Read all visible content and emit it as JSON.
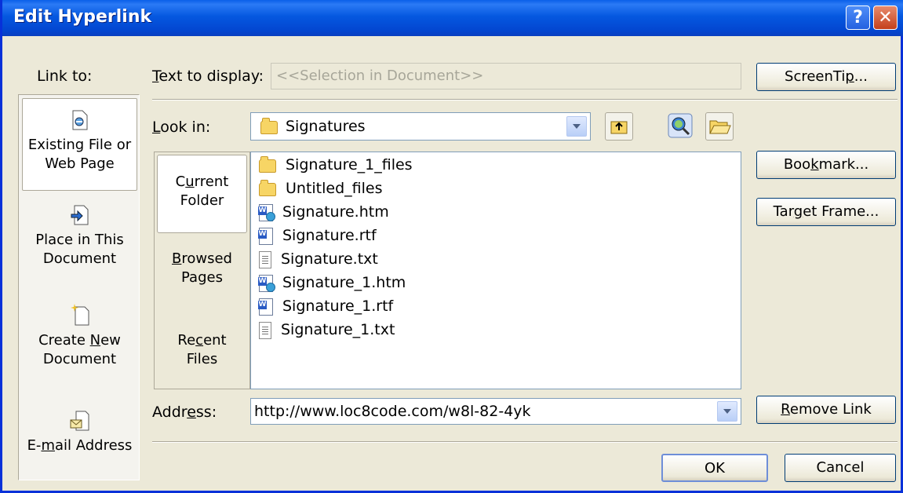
{
  "window": {
    "title": "Edit Hyperlink",
    "help_icon": "?",
    "close_icon": "✕"
  },
  "link_to": {
    "heading": "Link to:",
    "items": [
      {
        "label_line1": "Existing File or",
        "label_line2": "Web Page",
        "icon": "existing-file-icon",
        "selected": true
      },
      {
        "label_line1": "Place in This",
        "label_line2": "Document",
        "icon": "place-in-document-icon",
        "selected": false
      },
      {
        "label_line1": "Create New",
        "label_line2": "Document",
        "icon": "create-new-document-icon",
        "selected": false
      },
      {
        "label_line1": "E-mail Address",
        "label_line2": "",
        "icon": "email-address-icon",
        "selected": false
      }
    ]
  },
  "text_to_display": {
    "label": "Text to display:",
    "value": "<<Selection in Document>>"
  },
  "screentip_button": "ScreenTip...",
  "look_in": {
    "label": "Look in:",
    "value": "Signatures"
  },
  "browse_tabs": [
    {
      "line1": "Current",
      "line2": "Folder",
      "selected": true
    },
    {
      "line1": "Browsed",
      "line2": "Pages",
      "selected": false
    },
    {
      "line1": "Recent",
      "line2": "Files",
      "selected": false
    }
  ],
  "files": [
    {
      "name": "Signature_1_files",
      "type": "folder"
    },
    {
      "name": "Untitled_files",
      "type": "folder"
    },
    {
      "name": "Signature.htm",
      "type": "htm"
    },
    {
      "name": "Signature.rtf",
      "type": "rtf"
    },
    {
      "name": "Signature.txt",
      "type": "txt"
    },
    {
      "name": "Signature_1.htm",
      "type": "htm"
    },
    {
      "name": "Signature_1.rtf",
      "type": "rtf"
    },
    {
      "name": "Signature_1.txt",
      "type": "txt"
    }
  ],
  "side_buttons": {
    "bookmark": "Bookmark...",
    "target_frame": "Target Frame...",
    "remove_link": "Remove Link"
  },
  "address": {
    "label": "Address:",
    "value": "http://www.loc8code.com/w8l-82-4yk"
  },
  "ok_button": "OK",
  "cancel_button": "Cancel"
}
